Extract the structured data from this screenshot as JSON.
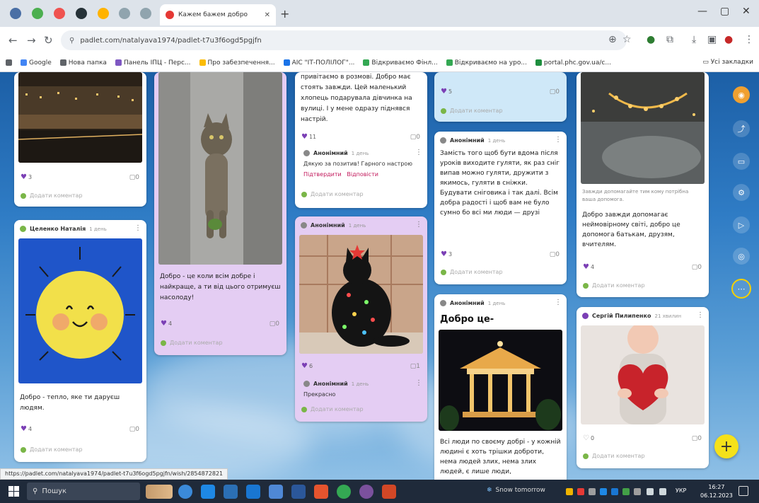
{
  "browser": {
    "tab_title": "Кажем бажем добро",
    "url": "padlet.com/natalyava1974/padlet-t7u3f6ogd5pgjfn",
    "bookmarks": [
      {
        "label": "Google",
        "color": "#4285f4"
      },
      {
        "label": "Нова папка",
        "color": "#5f6368"
      },
      {
        "label": "Панель ІПЦ - Перс...",
        "color": "#7e57c2"
      },
      {
        "label": "Про забезпечення...",
        "color": "#fbbc04"
      },
      {
        "label": "АІС \"ІТ-ПОЛІЛОГ\"...",
        "color": "#1a73e8"
      },
      {
        "label": "Відкриваємо Фінл...",
        "color": "#34a853"
      },
      {
        "label": "Відкриваємо на уро...",
        "color": "#34a853"
      },
      {
        "label": "portal.phc.gov.ua/c...",
        "color": "#1e8e3e"
      }
    ],
    "bookmarks_all": "Усі закладки"
  },
  "cards": {
    "c1": {
      "likes": "3",
      "comments": "0",
      "add_comment": "Додати коментар"
    },
    "c2": {
      "author": "Целенко Наталія",
      "time": "1 день",
      "text": "Добро - тепло, яке ти даруєш людям.",
      "likes": "4",
      "comments": "0",
      "add_comment": "Додати коментар"
    },
    "c3": {
      "text": "Добро - це коли всім добре і найкраще, а ти від цього отримуєш насолоду!",
      "likes": "4",
      "comments": "0",
      "add_comment": "Додати коментар"
    },
    "c4": {
      "text": "привітаємо в розмові. Добро має стоять завжди. Цей маленький хлопець подарувала дівчинка на вулиці. І у мене одразу піднявся настрій.",
      "likes": "11",
      "comments": "0",
      "reply_author": "Анонімний",
      "reply_time": "1 день",
      "reply_text": "Дякую за позитив! Гарного настрою",
      "reply_action1": "Підтвердити",
      "reply_action2": "Відповісти",
      "add_comment": "Додати коментар"
    },
    "c5": {
      "author": "Анонімний",
      "time": "1 день",
      "likes": "6",
      "comments": "1",
      "reply_author": "Анонімний",
      "reply_time": "1 день",
      "reply_text": "Прекрасно",
      "add_comment": "Додати коментар"
    },
    "c6": {
      "likes": "5",
      "comments": "0",
      "add_comment": "Додати коментар"
    },
    "c7": {
      "author": "Анонімний",
      "time": "1 день",
      "text": "Замість того щоб бути вдома після уроків виходите гуляти, як раз сніг випав можно гуляти, дружити з якимось, гуляти в сніжки. Будувати сніговика і так далі. Всім добра радості і щоб вам не було сумно бо всі ми люди — друзі",
      "likes": "3",
      "comments": "0",
      "add_comment": "Додати коментар"
    },
    "c8": {
      "author": "Анонімний",
      "time": "1 день",
      "heading": "Добро це-",
      "text": "Всі люди по своєму добрі - у кожній людині є хоть трішки доброти, нема людей злих, нема злих людей, є лише люди,"
    },
    "c9": {
      "caption": "Завжди допомагайте тим кому потрібна ваша допомога.",
      "text": "Добро завжди допомагає неймовірному світі, добро це допомога батькам, друзям, вчителям.",
      "likes": "4",
      "comments": "0",
      "add_comment": "Додати коментар"
    },
    "c10": {
      "author": "Сергій Пилипенко",
      "time": "21 хвилин",
      "likes": "0",
      "comments": "0",
      "add_comment": "Додати коментар"
    }
  },
  "status_url": "https://padlet.com/natalyava1974/padlet-t7u3f6ogd5pgjfn/wish/2854872821",
  "taskbar": {
    "search_placeholder": "Пошук",
    "weather": "Snow tomorrow",
    "time": "16:27",
    "date": "06.12.2023",
    "lang": "УКР"
  }
}
